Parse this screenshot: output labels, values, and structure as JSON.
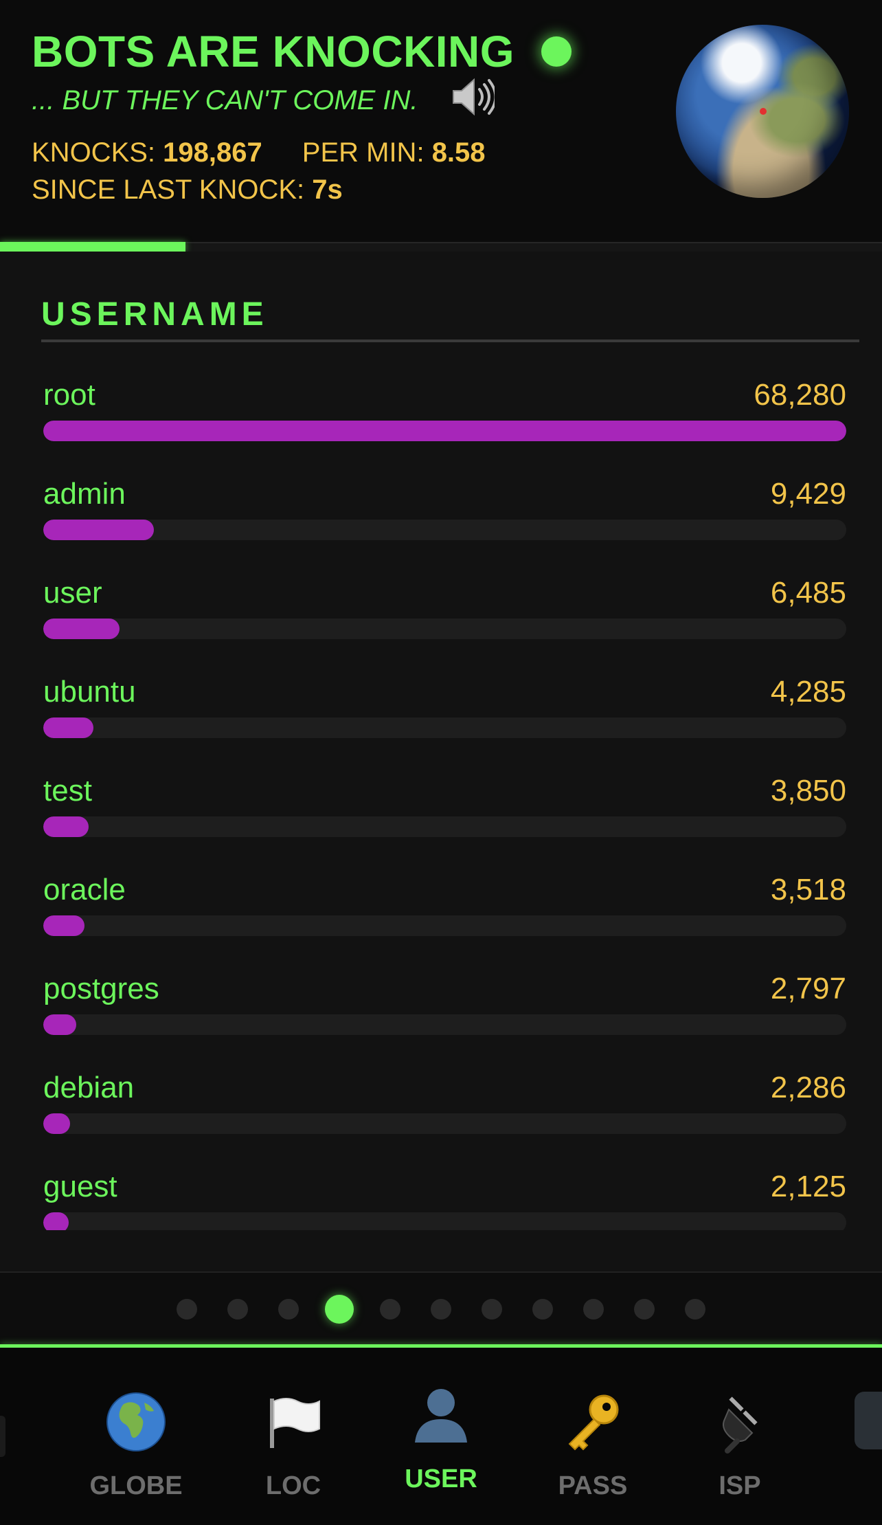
{
  "header": {
    "title": "BOTS ARE KNOCKING",
    "subtitle": "... BUT THEY CAN'T COME IN.",
    "knocks_label": "KNOCKS:",
    "knocks_value": "198,867",
    "per_min_label": "PER MIN:",
    "per_min_value": "8.58",
    "since_label": "SINCE LAST KNOCK:",
    "since_value": "7s",
    "progress_fraction": 0.21,
    "speaker_icon": "speaker-icon",
    "globe_icon": "globe-icon"
  },
  "section": {
    "title": "USERNAME",
    "max_value": 68280,
    "items": [
      {
        "label": "root",
        "value": "68,280",
        "count": 68280
      },
      {
        "label": "admin",
        "value": "9,429",
        "count": 9429
      },
      {
        "label": "user",
        "value": "6,485",
        "count": 6485
      },
      {
        "label": "ubuntu",
        "value": "4,285",
        "count": 4285
      },
      {
        "label": "test",
        "value": "3,850",
        "count": 3850
      },
      {
        "label": "oracle",
        "value": "3,518",
        "count": 3518
      },
      {
        "label": "postgres",
        "value": "2,797",
        "count": 2797
      },
      {
        "label": "debian",
        "value": "2,286",
        "count": 2286
      },
      {
        "label": "guest",
        "value": "2,125",
        "count": 2125
      }
    ]
  },
  "pager": {
    "count": 11,
    "active_index": 3
  },
  "nav": {
    "items": [
      {
        "label": "GLOBE",
        "icon": "globe-africa-icon",
        "active": false
      },
      {
        "label": "LOC",
        "icon": "white-flag-icon",
        "active": false
      },
      {
        "label": "USER",
        "icon": "user-silhouette-icon",
        "active": true
      },
      {
        "label": "PASS",
        "icon": "key-icon",
        "active": false
      },
      {
        "label": "ISP",
        "icon": "plug-icon",
        "active": false
      }
    ]
  },
  "colors": {
    "accent_green": "#6cf55c",
    "value_yellow": "#f2c44a",
    "bar_magenta": "#a726b9"
  }
}
